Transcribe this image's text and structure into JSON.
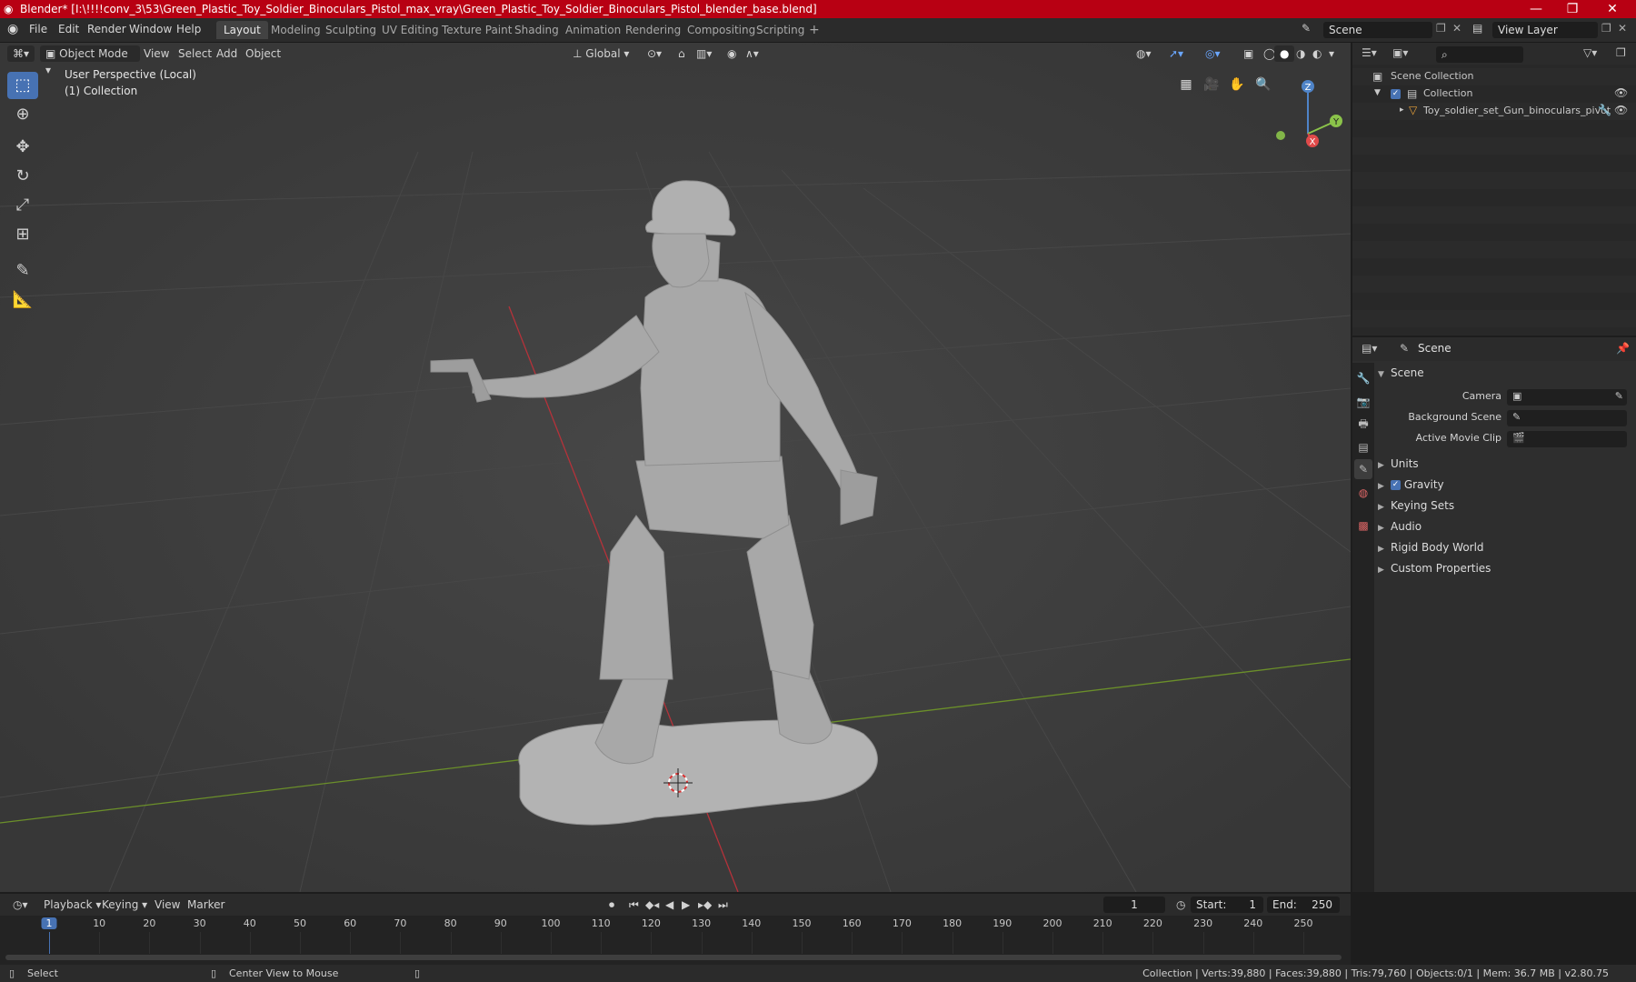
{
  "title_bar": {
    "title": "Blender* [I:\\!!!!conv_3\\53\\Green_Plastic_Toy_Soldier_Binoculars_Pistol_max_vray\\Green_Plastic_Toy_Soldier_Binoculars_Pistol_blender_base.blend]",
    "minimize": "—",
    "restore": "❐",
    "close": "✕"
  },
  "menu": [
    "File",
    "Edit",
    "Render",
    "Window",
    "Help"
  ],
  "workspaces": [
    "Layout",
    "Modeling",
    "Sculpting",
    "UV Editing",
    "Texture Paint",
    "Shading",
    "Animation",
    "Rendering",
    "Compositing",
    "Scripting"
  ],
  "add_workspace": "+",
  "scene_selector": "Scene",
  "view_layer": "View Layer",
  "viewport_header": {
    "mode": "Object Mode",
    "menus": [
      "View",
      "Select",
      "Add",
      "Object"
    ],
    "transform_orientation": "Global"
  },
  "viewport": {
    "perspective_label": "User Perspective (Local)",
    "collection_label": "(1) Collection",
    "gizmo": {
      "z": "Z",
      "y": "Y",
      "x": "X"
    },
    "colors": {
      "background": "#3c3c3c",
      "x_axis": "#b5323a",
      "y_axis": "#6b8f2a",
      "model": "#a8a8a8"
    }
  },
  "tools": [
    "select-box",
    "cursor",
    "move",
    "rotate",
    "scale",
    "transform",
    "annotate",
    "measure"
  ],
  "outliner": {
    "search_placeholder": "",
    "root": "Scene Collection",
    "collection": "Collection",
    "object": "Toy_soldier_set_Gun_binoculars_pivot"
  },
  "properties": {
    "header": "Scene",
    "panel": "Scene",
    "fields": [
      {
        "label": "Camera",
        "value": ""
      },
      {
        "label": "Background Scene",
        "value": ""
      },
      {
        "label": "Active Movie Clip",
        "value": ""
      }
    ],
    "sections": [
      "Units",
      "Gravity",
      "Keying Sets",
      "Audio",
      "Rigid Body World",
      "Custom Properties"
    ]
  },
  "timeline": {
    "menus": [
      "Playback",
      "Keying",
      "View",
      "Marker"
    ],
    "current_frame": "1",
    "start_label": "Start:",
    "start": "1",
    "end_label": "End:",
    "end": "250",
    "ticks": [
      "1",
      "10",
      "20",
      "30",
      "40",
      "50",
      "60",
      "70",
      "80",
      "90",
      "100",
      "110",
      "120",
      "130",
      "140",
      "150",
      "160",
      "170",
      "180",
      "190",
      "200",
      "210",
      "220",
      "230",
      "240",
      "250"
    ]
  },
  "status_bar": {
    "left_action": "Select",
    "mid_action": "Center View to Mouse",
    "stats": "Collection | Verts:39,880 | Faces:39,880 | Tris:79,760 | Objects:0/1 | Mem: 36.7 MB | v2.80.75"
  }
}
